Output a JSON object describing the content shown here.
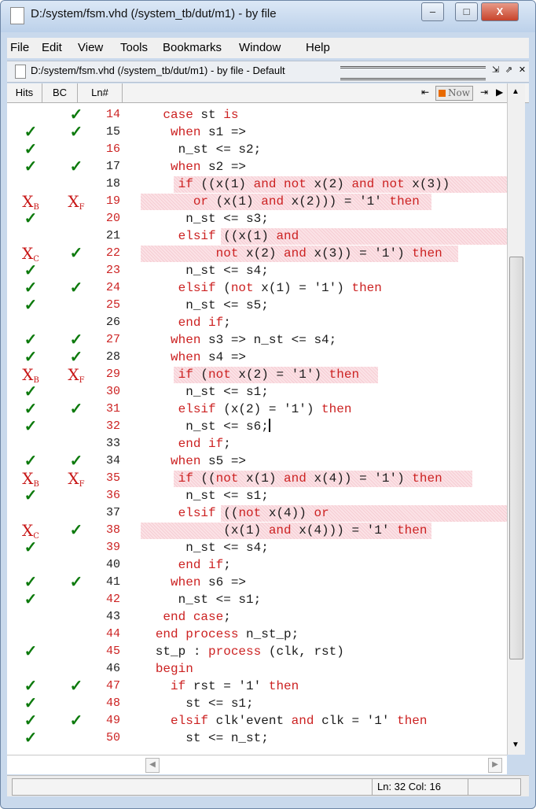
{
  "window": {
    "title": "D:/system/fsm.vhd (/system_tb/dut/m1) - by file",
    "minimize": "–",
    "maximize": "□",
    "close": "X"
  },
  "menu": [
    "File",
    "Edit",
    "View",
    "Tools",
    "Bookmarks",
    "Window",
    "Help"
  ],
  "document": {
    "title": "D:/system/fsm.vhd (/system_tb/dut/m1) - by file - Default",
    "buttons": [
      "⇲",
      "⇗",
      "✕"
    ]
  },
  "columns": {
    "hits": "Hits",
    "bc": "BC",
    "ln": "Ln#"
  },
  "toolbar": {
    "now_label": "Now",
    "back": "⇤",
    "fwd": "⇥"
  },
  "lines": [
    {
      "ln": "14",
      "hits": "",
      "bc": "ok",
      "lnc": "red",
      "code": [
        {
          "t": "    "
        },
        {
          "t": "case",
          "k": 1
        },
        {
          "t": " st "
        },
        {
          "t": "is",
          "k": 1
        }
      ]
    },
    {
      "ln": "15",
      "hits": "ok",
      "bc": "ok",
      "lnc": "black",
      "code": [
        {
          "t": "     "
        },
        {
          "t": "when",
          "k": 1
        },
        {
          "t": " s1 =>"
        }
      ]
    },
    {
      "ln": "16",
      "hits": "ok",
      "bc": "",
      "lnc": "red",
      "code": [
        {
          "t": "      n_st <= s2;"
        }
      ]
    },
    {
      "ln": "17",
      "hits": "ok",
      "bc": "ok",
      "lnc": "black",
      "code": [
        {
          "t": "     "
        },
        {
          "t": "when",
          "k": 1
        },
        {
          "t": " s2 =>"
        }
      ]
    },
    {
      "ln": "18",
      "hits": "",
      "bc": "",
      "lnc": "black",
      "hl": [
        52,
        447
      ],
      "code": [
        {
          "t": "      "
        },
        {
          "t": "if",
          "k": 1
        },
        {
          "t": " ((x(1) "
        },
        {
          "t": "and not",
          "k": 1
        },
        {
          "t": " x(2) "
        },
        {
          "t": "and not",
          "k": 1
        },
        {
          "t": " x(3))"
        }
      ]
    },
    {
      "ln": "19",
      "hits": "XB",
      "bc": "XF",
      "lnc": "red",
      "hl": [
        10,
        370
      ],
      "code": [
        {
          "t": "        "
        },
        {
          "t": "or",
          "k": 1
        },
        {
          "t": " (x(1) "
        },
        {
          "t": "and",
          "k": 1
        },
        {
          "t": " x(2))) = '1' "
        },
        {
          "t": "then",
          "k": 1
        }
      ]
    },
    {
      "ln": "20",
      "hits": "ok",
      "bc": "",
      "lnc": "red",
      "code": [
        {
          "t": "       n_st <= s3;"
        }
      ]
    },
    {
      "ln": "21",
      "hits": "",
      "bc": "",
      "lnc": "black",
      "hl": [
        112,
        447
      ],
      "code": [
        {
          "t": "      "
        },
        {
          "t": "elsif",
          "k": 1
        },
        {
          "t": " ((x(1) "
        },
        {
          "t": "and",
          "k": 1
        }
      ]
    },
    {
      "ln": "22",
      "hits": "XC",
      "bc": "ok",
      "lnc": "red",
      "hl": [
        10,
        404
      ],
      "code": [
        {
          "t": "           "
        },
        {
          "t": "not",
          "k": 1
        },
        {
          "t": " x(2) "
        },
        {
          "t": "and",
          "k": 1
        },
        {
          "t": " x(3)) = '1') "
        },
        {
          "t": "then",
          "k": 1
        }
      ]
    },
    {
      "ln": "23",
      "hits": "ok",
      "bc": "",
      "lnc": "red",
      "code": [
        {
          "t": "       n_st <= s4;"
        }
      ]
    },
    {
      "ln": "24",
      "hits": "ok",
      "bc": "ok",
      "lnc": "red",
      "code": [
        {
          "t": "      "
        },
        {
          "t": "elsif",
          "k": 1
        },
        {
          "t": " ("
        },
        {
          "t": "not",
          "k": 1
        },
        {
          "t": " x(1) = '1') "
        },
        {
          "t": "then",
          "k": 1
        }
      ]
    },
    {
      "ln": "25",
      "hits": "ok",
      "bc": "",
      "lnc": "red",
      "code": [
        {
          "t": "       n_st <= s5;"
        }
      ]
    },
    {
      "ln": "26",
      "hits": "",
      "bc": "",
      "lnc": "black",
      "code": [
        {
          "t": "      "
        },
        {
          "t": "end if",
          "k": 1
        },
        {
          "t": ";"
        }
      ]
    },
    {
      "ln": "27",
      "hits": "ok",
      "bc": "ok",
      "lnc": "red",
      "code": [
        {
          "t": "     "
        },
        {
          "t": "when",
          "k": 1
        },
        {
          "t": " s3 => n_st <= s4;"
        }
      ]
    },
    {
      "ln": "28",
      "hits": "ok",
      "bc": "ok",
      "lnc": "black",
      "code": [
        {
          "t": "     "
        },
        {
          "t": "when",
          "k": 1
        },
        {
          "t": " s4 =>"
        }
      ]
    },
    {
      "ln": "29",
      "hits": "XB",
      "bc": "XF",
      "lnc": "red",
      "hl": [
        52,
        260
      ],
      "code": [
        {
          "t": "      "
        },
        {
          "t": "if",
          "k": 1
        },
        {
          "t": " ("
        },
        {
          "t": "not",
          "k": 1
        },
        {
          "t": " x(2) = '1') "
        },
        {
          "t": "then",
          "k": 1
        }
      ]
    },
    {
      "ln": "30",
      "hits": "ok",
      "bc": "",
      "lnc": "red",
      "code": [
        {
          "t": "       n_st <= s1;"
        }
      ]
    },
    {
      "ln": "31",
      "hits": "ok",
      "bc": "ok",
      "lnc": "red",
      "code": [
        {
          "t": "      "
        },
        {
          "t": "elsif",
          "k": 1
        },
        {
          "t": " (x(2) = '1') "
        },
        {
          "t": "then",
          "k": 1
        }
      ]
    },
    {
      "ln": "32",
      "hits": "ok",
      "bc": "",
      "lnc": "red",
      "cursor": true,
      "code": [
        {
          "t": "       n_st <= s6;"
        }
      ]
    },
    {
      "ln": "33",
      "hits": "",
      "bc": "",
      "lnc": "black",
      "code": [
        {
          "t": "      "
        },
        {
          "t": "end if",
          "k": 1
        },
        {
          "t": ";"
        }
      ]
    },
    {
      "ln": "34",
      "hits": "ok",
      "bc": "ok",
      "lnc": "black",
      "code": [
        {
          "t": "     "
        },
        {
          "t": "when",
          "k": 1
        },
        {
          "t": " s5 =>"
        }
      ]
    },
    {
      "ln": "35",
      "hits": "XB",
      "bc": "XF",
      "lnc": "red",
      "hl": [
        52,
        380
      ],
      "code": [
        {
          "t": "      "
        },
        {
          "t": "if",
          "k": 1
        },
        {
          "t": " (("
        },
        {
          "t": "not",
          "k": 1
        },
        {
          "t": " x(1) "
        },
        {
          "t": "and",
          "k": 1
        },
        {
          "t": " x(4)) = '1') "
        },
        {
          "t": "then",
          "k": 1
        }
      ]
    },
    {
      "ln": "36",
      "hits": "ok",
      "bc": "",
      "lnc": "red",
      "code": [
        {
          "t": "       n_st <= s1;"
        }
      ]
    },
    {
      "ln": "37",
      "hits": "",
      "bc": "",
      "lnc": "black",
      "hl": [
        112,
        447
      ],
      "code": [
        {
          "t": "      "
        },
        {
          "t": "elsif",
          "k": 1
        },
        {
          "t": " (("
        },
        {
          "t": "not",
          "k": 1
        },
        {
          "t": " x(4)) "
        },
        {
          "t": "or",
          "k": 1
        }
      ]
    },
    {
      "ln": "38",
      "hits": "XC",
      "bc": "ok",
      "lnc": "red",
      "hl": [
        10,
        370
      ],
      "code": [
        {
          "t": "            (x(1) "
        },
        {
          "t": "and",
          "k": 1
        },
        {
          "t": " x(4))) = '1' "
        },
        {
          "t": "then",
          "k": 1
        }
      ]
    },
    {
      "ln": "39",
      "hits": "ok",
      "bc": "",
      "lnc": "red",
      "code": [
        {
          "t": "       n_st <= s4;"
        }
      ]
    },
    {
      "ln": "40",
      "hits": "",
      "bc": "",
      "lnc": "black",
      "code": [
        {
          "t": "      "
        },
        {
          "t": "end if",
          "k": 1
        },
        {
          "t": ";"
        }
      ]
    },
    {
      "ln": "41",
      "hits": "ok",
      "bc": "ok",
      "lnc": "black",
      "code": [
        {
          "t": "     "
        },
        {
          "t": "when",
          "k": 1
        },
        {
          "t": " s6 =>"
        }
      ]
    },
    {
      "ln": "42",
      "hits": "ok",
      "bc": "",
      "lnc": "red",
      "code": [
        {
          "t": "      n_st <= s1;"
        }
      ]
    },
    {
      "ln": "43",
      "hits": "",
      "bc": "",
      "lnc": "black",
      "code": [
        {
          "t": "    "
        },
        {
          "t": "end case",
          "k": 1
        },
        {
          "t": ";"
        }
      ]
    },
    {
      "ln": "44",
      "hits": "",
      "bc": "",
      "lnc": "red",
      "code": [
        {
          "t": "   "
        },
        {
          "t": "end process",
          "k": 1
        },
        {
          "t": " n_st_p;"
        }
      ]
    },
    {
      "ln": "45",
      "hits": "ok",
      "bc": "",
      "lnc": "red",
      "code": [
        {
          "t": "   st_p : "
        },
        {
          "t": "process",
          "k": 1
        },
        {
          "t": " (clk, rst)"
        }
      ]
    },
    {
      "ln": "46",
      "hits": "",
      "bc": "",
      "lnc": "black",
      "code": [
        {
          "t": "   "
        },
        {
          "t": "begin",
          "k": 1
        }
      ]
    },
    {
      "ln": "47",
      "hits": "ok",
      "bc": "ok",
      "lnc": "red",
      "code": [
        {
          "t": "     "
        },
        {
          "t": "if",
          "k": 1
        },
        {
          "t": " rst = '1' "
        },
        {
          "t": "then",
          "k": 1
        }
      ]
    },
    {
      "ln": "48",
      "hits": "ok",
      "bc": "",
      "lnc": "red",
      "code": [
        {
          "t": "       st <= s1;"
        }
      ]
    },
    {
      "ln": "49",
      "hits": "ok",
      "bc": "ok",
      "lnc": "red",
      "code": [
        {
          "t": "     "
        },
        {
          "t": "elsif",
          "k": 1
        },
        {
          "t": " clk'event "
        },
        {
          "t": "and",
          "k": 1
        },
        {
          "t": " clk = '1' "
        },
        {
          "t": "then",
          "k": 1
        }
      ]
    },
    {
      "ln": "50",
      "hits": "ok",
      "bc": "",
      "lnc": "red",
      "code": [
        {
          "t": "       st <= n_st;"
        }
      ]
    }
  ],
  "status": {
    "position": "Ln:  32 Col: 16"
  },
  "colors": {
    "keyword": "#cc2222",
    "covered": "#0d7a0d",
    "missed": "#c81818"
  }
}
